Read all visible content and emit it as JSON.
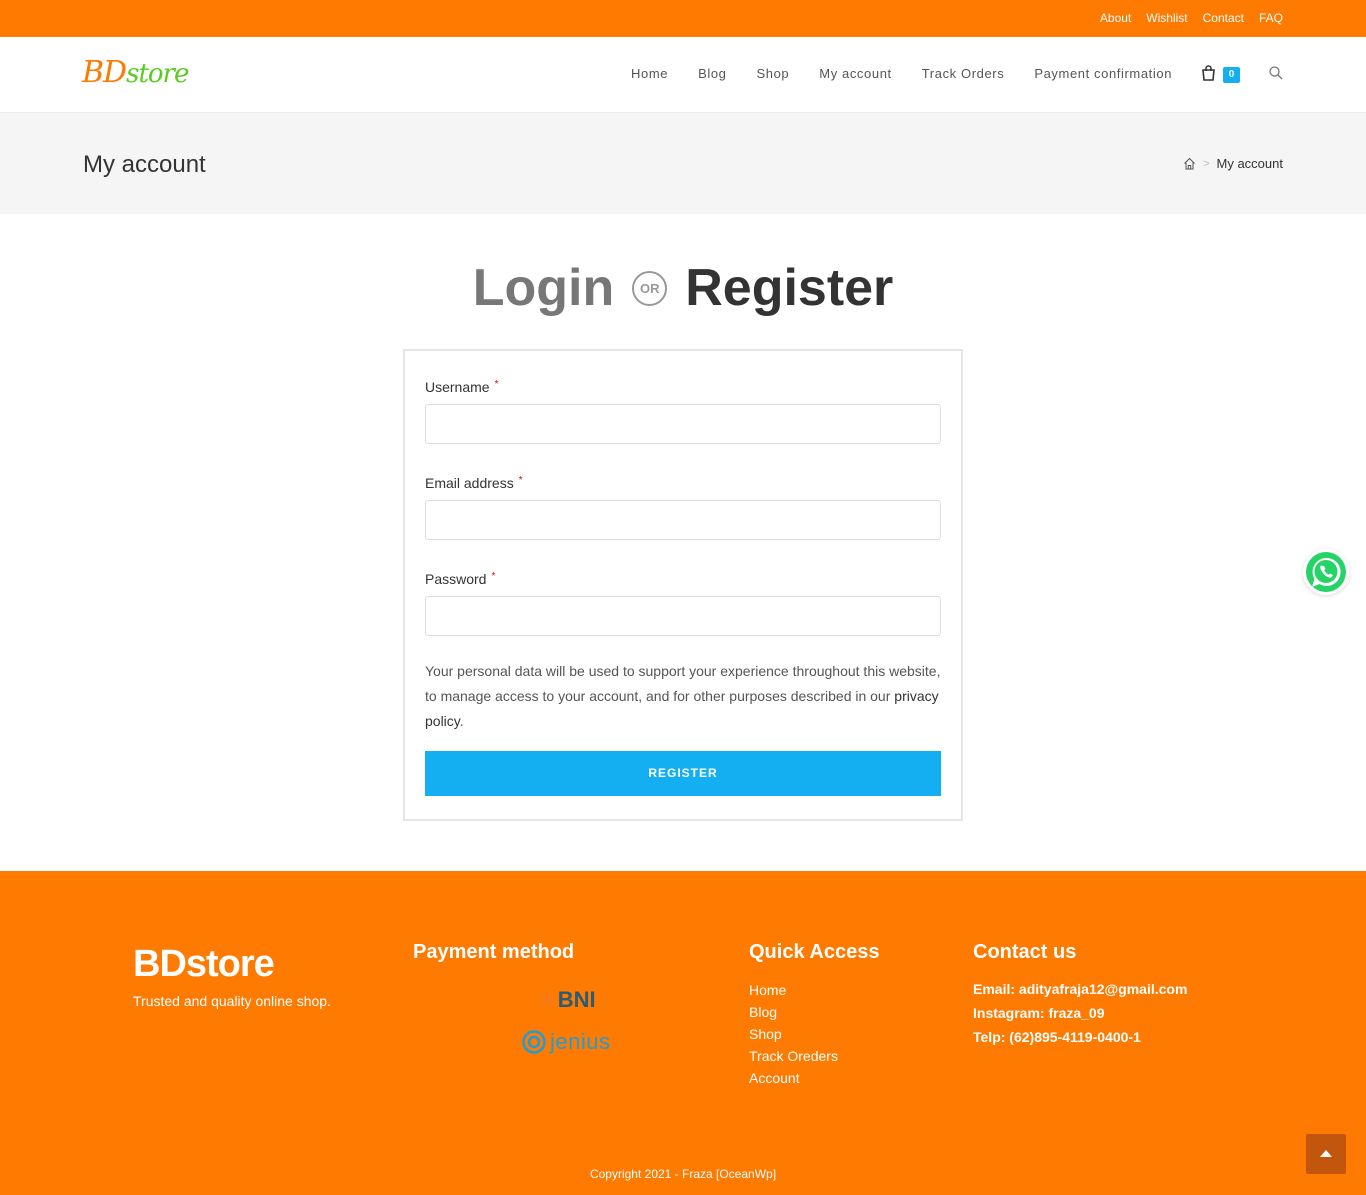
{
  "topbar": {
    "links": [
      "About",
      "Wishlist",
      "Contact",
      "FAQ"
    ]
  },
  "header": {
    "logo_bd": "BD",
    "logo_store": "store",
    "nav": [
      "Home",
      "Blog",
      "Shop",
      "My account",
      "Track Orders",
      "Payment confirmation"
    ],
    "cart_count": "0"
  },
  "page_header": {
    "title": "My account",
    "breadcrumb_current": "My account",
    "breadcrumb_separator": ">"
  },
  "form_heading": {
    "login": "Login",
    "or": "OR",
    "register": "Register"
  },
  "form": {
    "username_label": "Username",
    "email_label": "Email address",
    "password_label": "Password",
    "required_mark": "*",
    "privacy_text": "Your personal data will be used to support your experience throughout this website, to manage access to your account, and for other purposes described in our ",
    "privacy_link": "privacy policy",
    "privacy_end": ".",
    "register_button": "REGISTER"
  },
  "footer": {
    "brand": "BDstore",
    "tagline": "Trusted and quality online shop.",
    "payment_heading": "Payment method",
    "payment_bni": "BNI",
    "payment_jenius": "jenius",
    "quick_heading": "Quick Access",
    "quick_links": [
      "Home",
      "Blog",
      "Shop",
      "Track Oreders",
      "Account"
    ],
    "contact_heading": "Contact us",
    "contact_email": "Email: adityafraja12@gmail.com",
    "contact_instagram": "Instagram: fraza_09",
    "contact_phone": "Telp: (62)895-4119-0400-1",
    "copyright": "Copyright 2021 - Fraza [OceanWp]"
  },
  "colors": {
    "orange": "#ff7a00",
    "blue": "#13aff0",
    "green": "#58cc1f",
    "whatsapp": "#25d366"
  }
}
